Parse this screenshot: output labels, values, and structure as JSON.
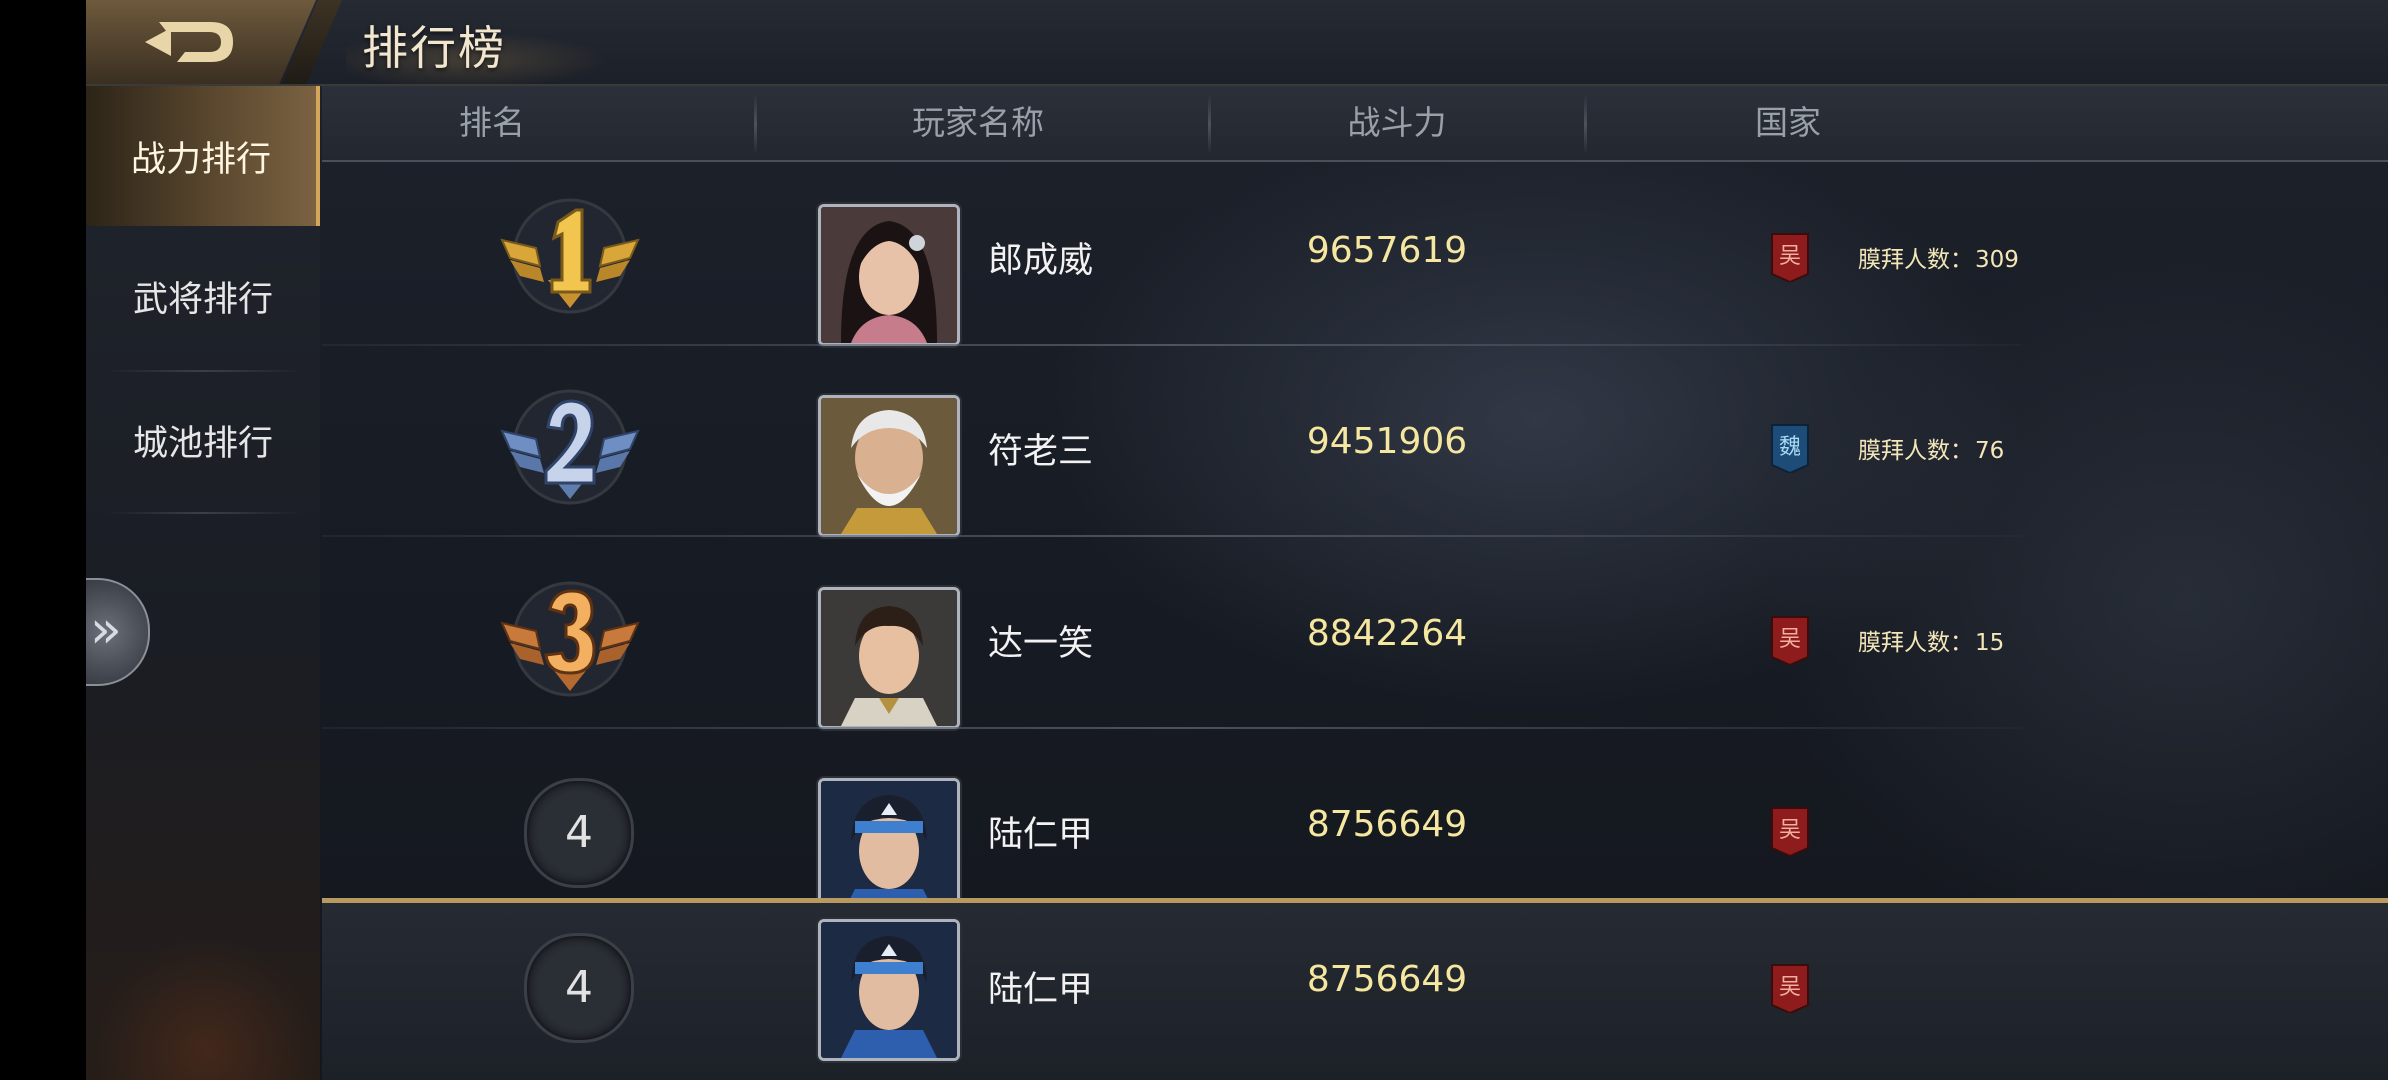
{
  "header": {
    "title": "排行榜"
  },
  "sidebar": {
    "tabs": [
      {
        "label": "战力排行",
        "active": true
      },
      {
        "label": "武将排行",
        "active": false
      },
      {
        "label": "城池排行",
        "active": false
      }
    ]
  },
  "columns": {
    "rank": "排名",
    "player": "玩家名称",
    "power": "战斗力",
    "country": "国家"
  },
  "worship_label": "膜拜人数：",
  "rows": [
    {
      "rank": "1",
      "badge": "gold",
      "name": "郎成威",
      "power": "9657619",
      "country": "吴",
      "worship": "309"
    },
    {
      "rank": "2",
      "badge": "silver",
      "name": "符老三",
      "power": "9451906",
      "country": "魏",
      "worship": "76"
    },
    {
      "rank": "3",
      "badge": "bronze",
      "name": "达一笑",
      "power": "8842264",
      "country": "吴",
      "worship": "15"
    },
    {
      "rank": "4",
      "badge": "plain",
      "name": "陆仁甲",
      "power": "8756649",
      "country": "吴"
    }
  ],
  "my_rank": {
    "rank": "4",
    "name": "陆仁甲",
    "power": "8756649",
    "country": "吴"
  },
  "colors": {
    "gold": "#d9a63a",
    "silver": "#6f8fc4",
    "bronze": "#c77a3c",
    "power_text": "#f6e7a0",
    "wu_flag": "#8e1c1c",
    "wei_flag": "#1e4c78",
    "accent": "#b8995f"
  },
  "icons": {
    "back": "back-arrow-icon",
    "expand": "double-chevron-right-icon"
  }
}
